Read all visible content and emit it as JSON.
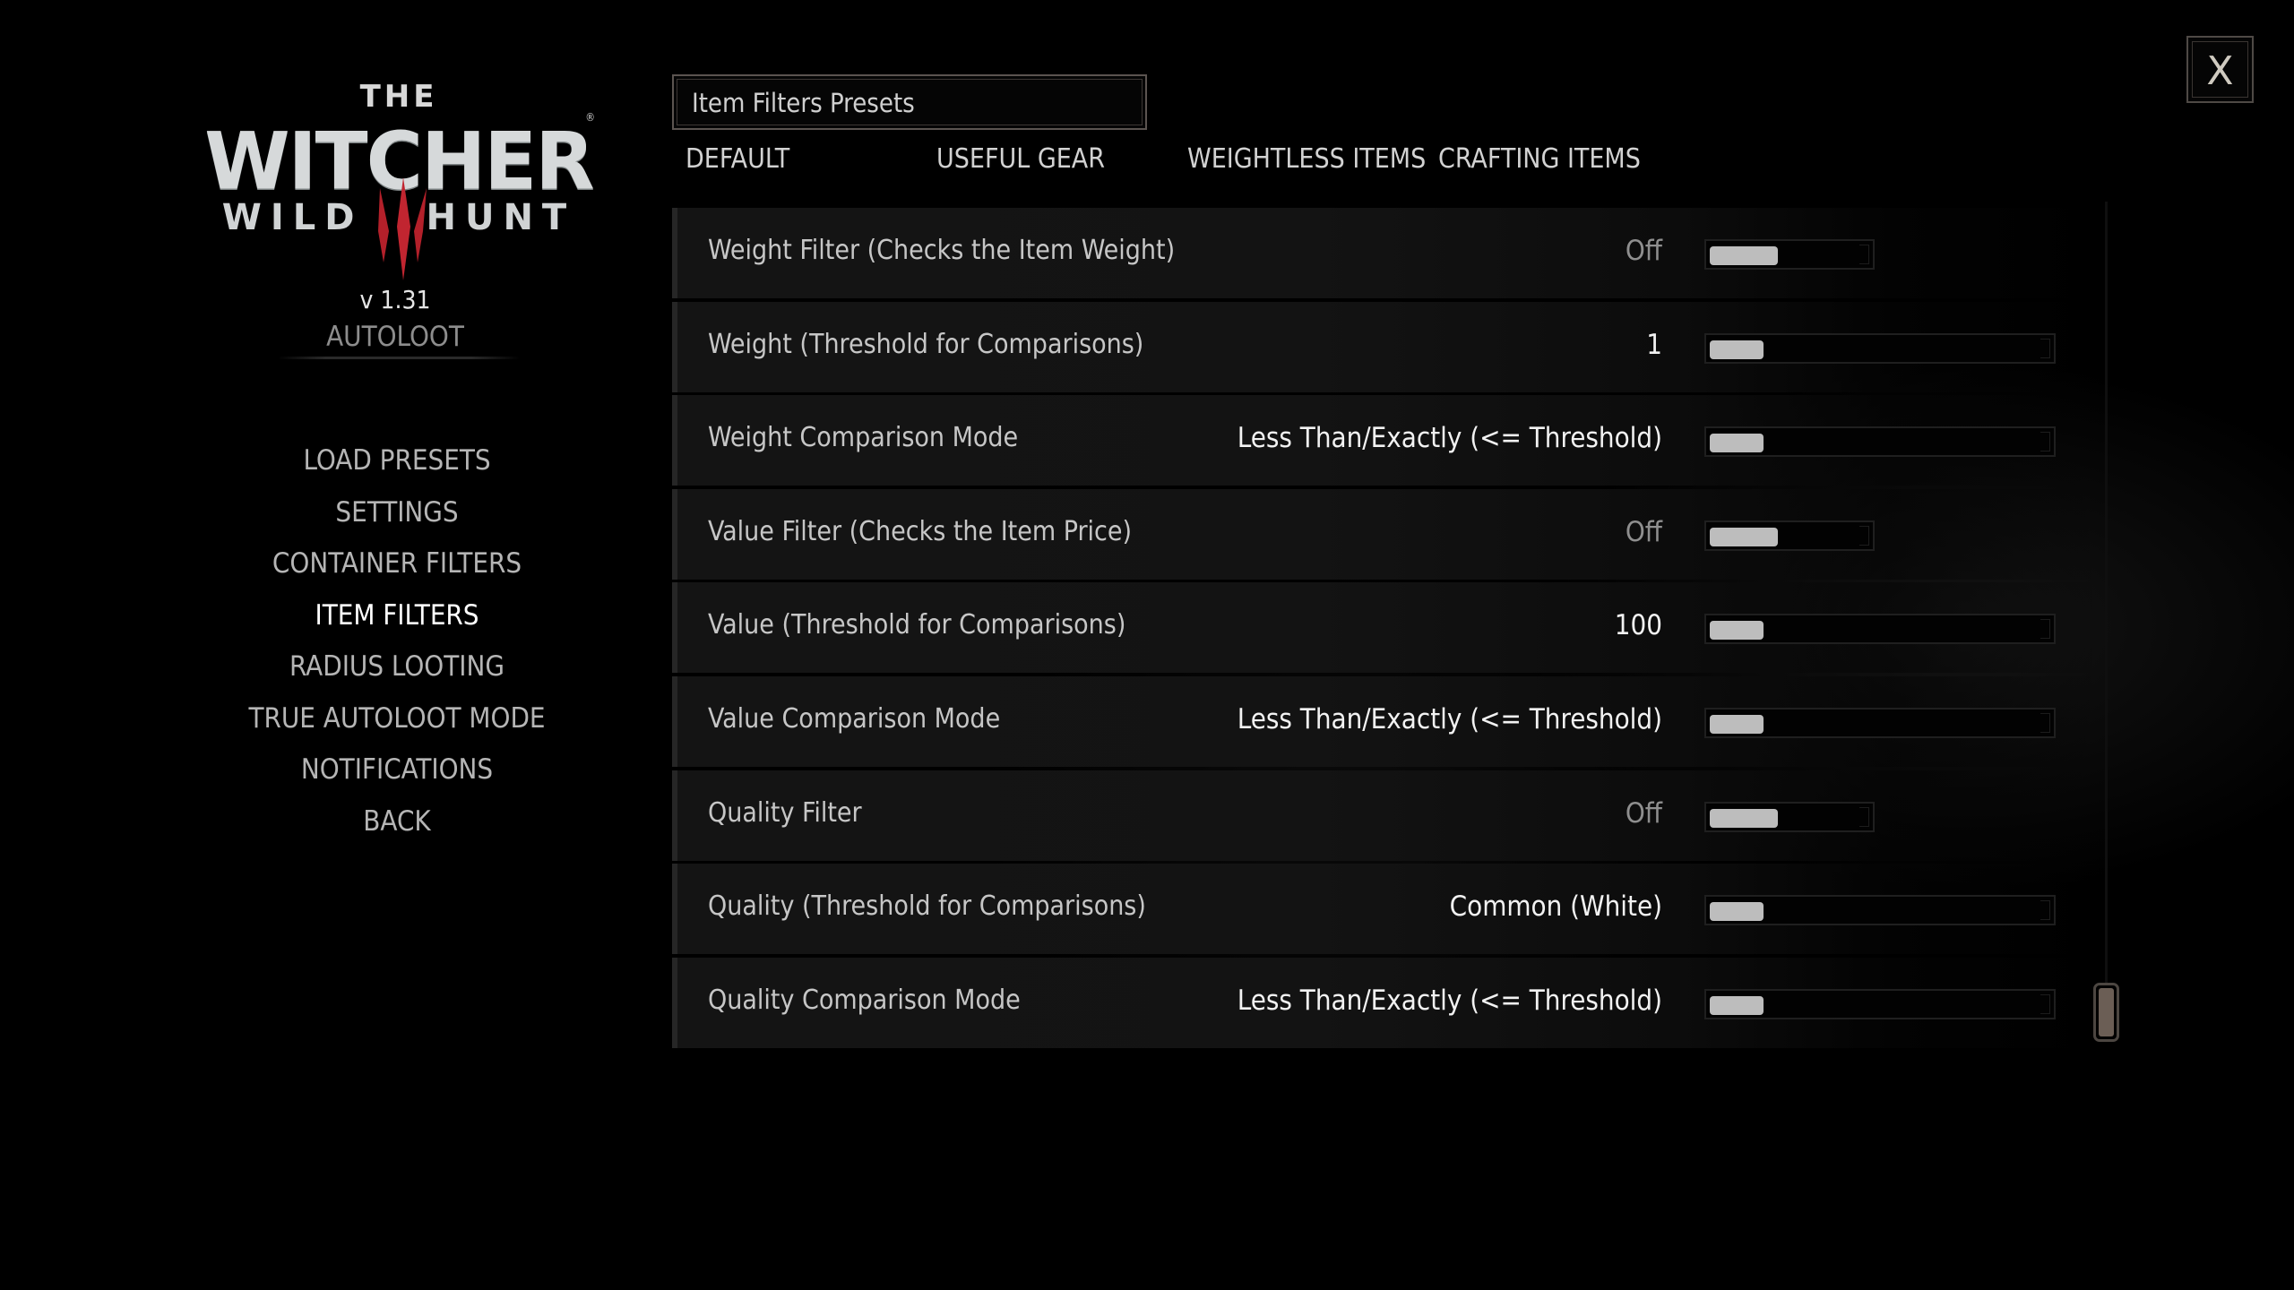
{
  "logo": {
    "the": "THE",
    "witcher": "WITCHER",
    "wild": "WILD",
    "hunt": "HUNT",
    "registered": "®",
    "claw_color": "#b3202a"
  },
  "version": "v 1.31",
  "mod_name": "AUTOLOOT",
  "menu": {
    "active_index": 3,
    "items": [
      {
        "label": "LOAD PRESETS"
      },
      {
        "label": "SETTINGS"
      },
      {
        "label": "CONTAINER FILTERS"
      },
      {
        "label": "ITEM FILTERS"
      },
      {
        "label": "RADIUS LOOTING"
      },
      {
        "label": "TRUE AUTOLOOT MODE"
      },
      {
        "label": "NOTIFICATIONS"
      },
      {
        "label": "BACK"
      }
    ]
  },
  "presets": {
    "title": "Item Filters Presets",
    "tabs": [
      {
        "label": "DEFAULT"
      },
      {
        "label": "USEFUL GEAR"
      },
      {
        "label": "WEIGHTLESS ITEMS"
      },
      {
        "label": "CRAFTING ITEMS"
      }
    ]
  },
  "options": [
    {
      "label": "Weight Filter (Checks the Item Weight)",
      "value": "Off",
      "type": "toggle"
    },
    {
      "label": "Weight (Threshold for Comparisons)",
      "value": "1",
      "type": "slider"
    },
    {
      "label": "Weight Comparison Mode",
      "value": "Less Than/Exactly (<= Threshold)",
      "type": "slider"
    },
    {
      "label": "Value Filter (Checks the Item Price)",
      "value": "Off",
      "type": "toggle"
    },
    {
      "label": "Value (Threshold for Comparisons)",
      "value": "100",
      "type": "slider"
    },
    {
      "label": "Value Comparison Mode",
      "value": "Less Than/Exactly (<= Threshold)",
      "type": "slider"
    },
    {
      "label": "Quality Filter",
      "value": "Off",
      "type": "toggle"
    },
    {
      "label": "Quality (Threshold for Comparisons)",
      "value": "Common (White)",
      "type": "slider"
    },
    {
      "label": "Quality Comparison Mode",
      "value": "Less Than/Exactly (<= Threshold)",
      "type": "slider"
    }
  ],
  "close_button": {
    "label": "X"
  },
  "scroll_position": "bottom"
}
